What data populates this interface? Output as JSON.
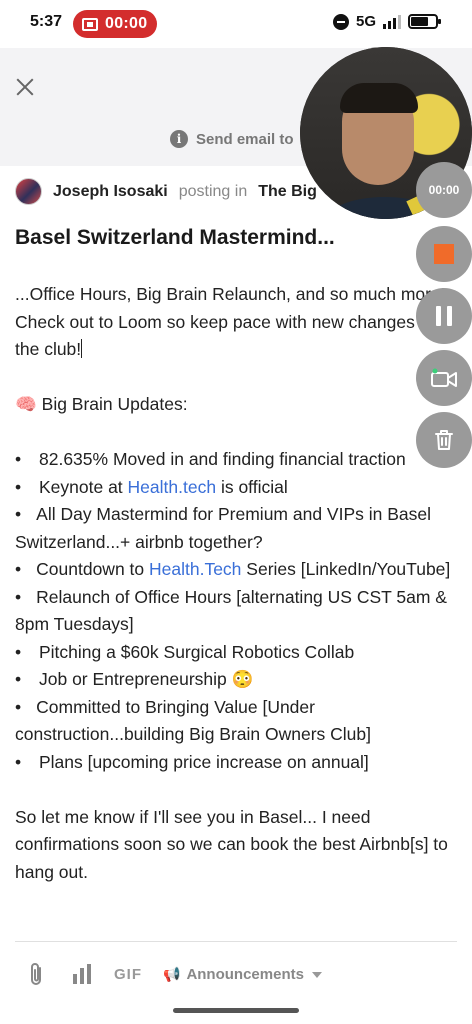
{
  "status_bar": {
    "time": "5:37",
    "recording_time": "00:00",
    "network": "5G"
  },
  "header": {
    "email_notice": "Send email to"
  },
  "post": {
    "author": "Joseph Isosaki",
    "posting_in": "posting in",
    "group": "The Big",
    "title": "Basel Switzerland Mastermind...",
    "intro": "...Office Hours, Big Brain Relaunch, and so much more! Check out to Loom so keep pace with new changes in the club!",
    "updates_heading": "🧠 Big Brain Updates:",
    "bullets": [
      {
        "text": "82.635% Moved in and finding financial traction"
      },
      {
        "pre": "Keynote at ",
        "link": "Health.tech",
        "post": " is official"
      },
      {
        "text": "All Day Mastermind for Premium and VIPs in Basel Switzerland...+ airbnb together?"
      },
      {
        "pre": "Countdown to ",
        "link": "Health.Tech",
        "post": " Series [LinkedIn/YouTube]"
      },
      {
        "text": "Relaunch of Office Hours [alternating US CST 5am & 8pm Tuesdays]"
      },
      {
        "text": "Pitching a $60k Surgical Robotics Collab"
      },
      {
        "text": "Job or Entrepreneurship 😳"
      },
      {
        "text": "Committed to Bringing Value [Under construction...building Big Brain Owners Club]"
      },
      {
        "text": "Plans [upcoming price increase on annual]"
      }
    ],
    "closing": "So let me know if I'll see you in Basel... I need confirmations soon so we can book the best Airbnb[s] to hang out."
  },
  "toolbar": {
    "gif_label": "GIF",
    "channel_label": "Announcements",
    "channel_icon": "📢"
  },
  "loom": {
    "timer": "00:00",
    "stop_color": "#f06b2a"
  }
}
